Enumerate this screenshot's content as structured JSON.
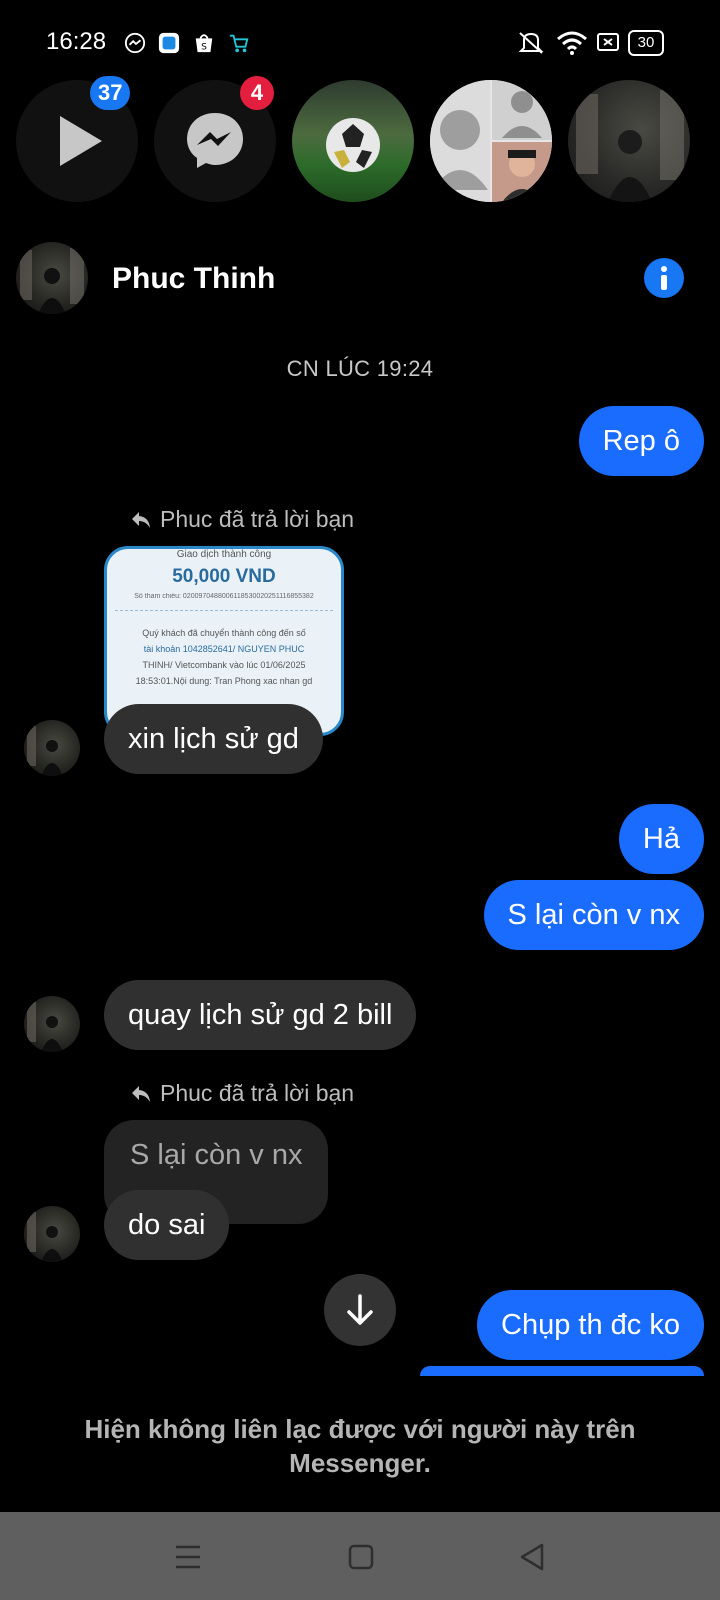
{
  "status_bar": {
    "time": "16:28",
    "app_icons": [
      "messenger-icon",
      "blue-app-icon",
      "shopee-icon",
      "cart-app-icon"
    ],
    "right_icons": [
      "mute-icon",
      "wifi-icon",
      "sim-icon",
      "battery-icon"
    ],
    "battery": "30"
  },
  "chatheads": [
    {
      "name": "video-chathead",
      "badge": "37",
      "badge_color": "#1877f2"
    },
    {
      "name": "messenger-chathead",
      "badge": "4",
      "badge_color": "#e41e3f"
    },
    {
      "name": "football-chathead"
    },
    {
      "name": "group-chathead"
    },
    {
      "name": "phuc-chathead"
    }
  ],
  "header": {
    "name": "Phuc Thinh"
  },
  "conversation": {
    "timestamp": "CN LÚC 19:24",
    "msg1": "Rep ô",
    "reply_note_1": "Phuc đã trả lời bạn",
    "bill": {
      "title": "Giao dịch thành công",
      "amount": "50,000 VND",
      "ref": "Số tham chiếu: 0200970488006118530020251116855382",
      "line1": "Quý khách đã chuyển thành công đến số",
      "line2": "tài khoản 1042852641/ NGUYEN PHUC",
      "line3": "THINH/ Vietcombank vào lúc 01/06/2025",
      "line4": "18:53:01.Nội dung: Tran Phong xac nhan gd"
    },
    "msg2": "xin lịch sử gd",
    "msg3": "Hả",
    "msg4": "S lại còn v nx",
    "msg5": "quay lịch sử gd 2 bill",
    "reply_note_2": "Phuc đã trả lời bạn",
    "quoted": "S lại còn v nx",
    "msg6": "do sai",
    "msg7": "Chụp th đc ko"
  },
  "notice": "Hiện không liên lạc được với người này trên Messenger.",
  "colors": {
    "outgoing": "#1a6cff",
    "incoming": "#303030",
    "background": "#000000",
    "navbar": "#5f5f5f"
  }
}
